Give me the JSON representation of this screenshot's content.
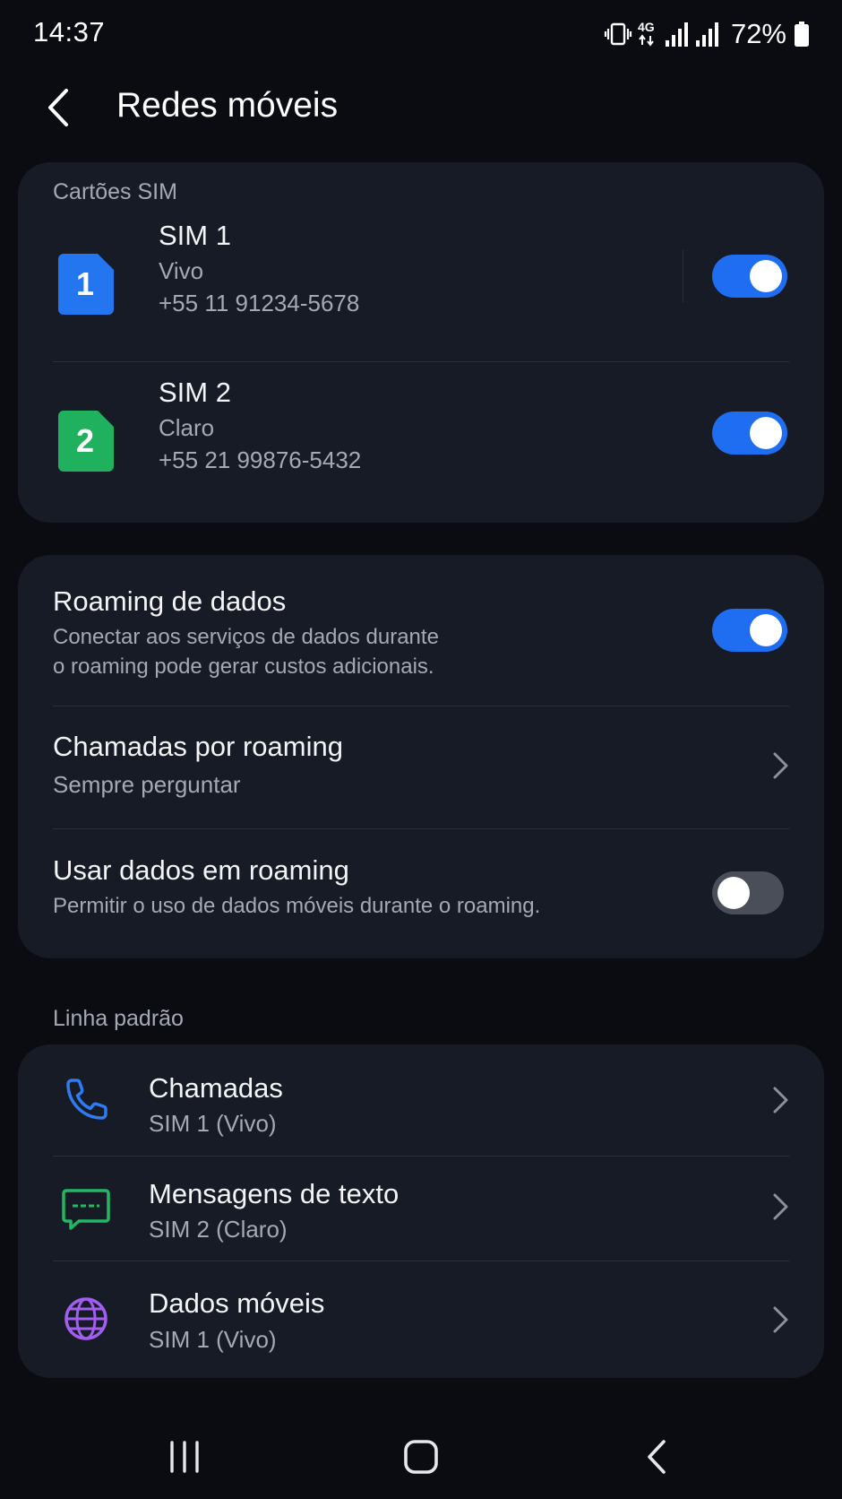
{
  "status_bar": {
    "time": "14:37",
    "network_type": "4G",
    "battery_percent": "72%",
    "icons": [
      "vibrate-icon",
      "network-4g-icon",
      "signal-icon",
      "signal-icon",
      "battery-icon"
    ]
  },
  "header": {
    "title": "Redes móveis",
    "back_icon": "back-arrow-icon"
  },
  "sim_cards": {
    "section_label": "Cartões SIM",
    "items": [
      {
        "badge": "1",
        "name": "SIM 1",
        "carrier": "Vivo",
        "number": "+55 11 91234-5678",
        "enabled": true,
        "color": "#2475f0"
      },
      {
        "badge": "2",
        "name": "SIM 2",
        "carrier": "Claro",
        "number": "+55 21 99876-5432",
        "enabled": true,
        "color": "#1fb15d"
      }
    ]
  },
  "roaming": {
    "data_roaming": {
      "title": "Roaming de dados",
      "description_line1": "Conectar aos serviços de dados durante",
      "description_line2": "o roaming pode gerar custos adicionais.",
      "enabled": true
    },
    "roaming_calls": {
      "title": "Chamadas por roaming",
      "value": "Sempre perguntar"
    },
    "use_roaming_data": {
      "title": "Usar dados em roaming",
      "description": "Permitir o uso de dados móveis durante o roaming.",
      "enabled": false
    }
  },
  "default_line": {
    "section_label": "Linha padrão",
    "items": [
      {
        "title": "Chamadas",
        "value": "SIM 1 (Vivo)",
        "icon": "phone-icon",
        "icon_color": "#2f7bf0"
      },
      {
        "title": "Mensagens de texto",
        "value": "SIM 2 (Claro)",
        "icon": "message-icon",
        "icon_color": "#22b863"
      },
      {
        "title": "Dados móveis",
        "value": "SIM 1 (Vivo)",
        "icon": "globe-icon",
        "icon_color": "#a15ef0"
      }
    ]
  },
  "nav_bar": {
    "icons": [
      "recent-apps-icon",
      "home-icon",
      "back-icon"
    ]
  },
  "colors": {
    "background": "#0a0c12",
    "card": "#171b25",
    "accent": "#1f6ef2",
    "text_primary": "#f3f4f6",
    "text_secondary": "#a4a9b5"
  }
}
